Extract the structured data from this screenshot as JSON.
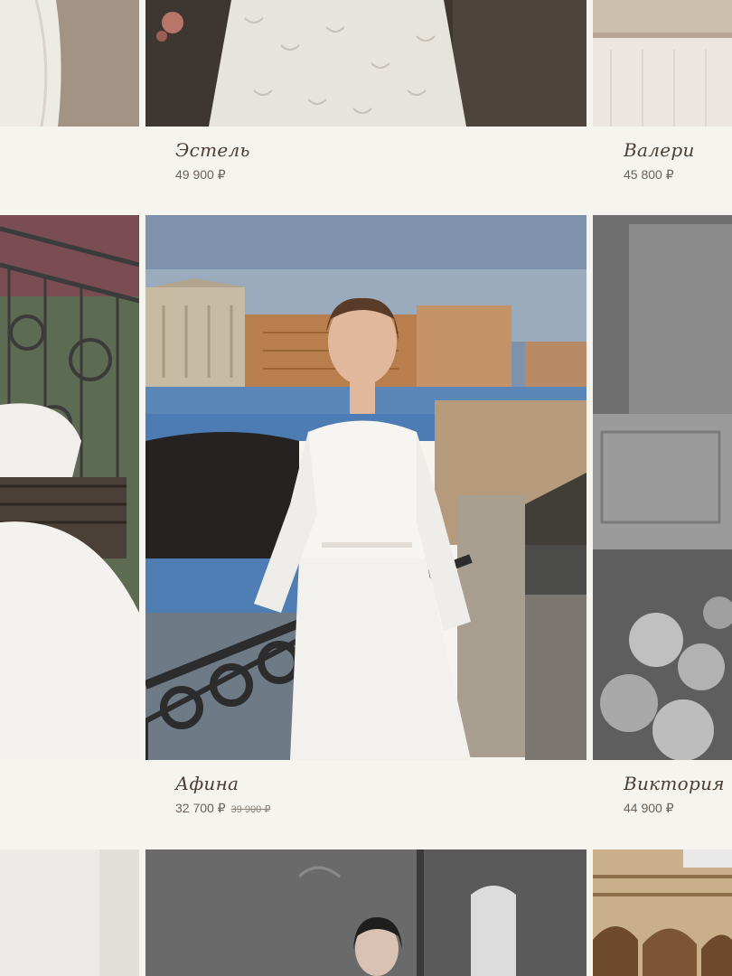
{
  "currency": "₽",
  "products": {
    "row1": {
      "center": {
        "name": "Эстель",
        "price": "49 900 ₽"
      },
      "right": {
        "name": "Валери",
        "price": "45 800 ₽"
      }
    },
    "row2": {
      "center": {
        "name": "Афина",
        "price": "32 700 ₽",
        "old_price": "39 900 ₽"
      },
      "right": {
        "name": "Виктория",
        "price": "44 900 ₽"
      }
    }
  }
}
